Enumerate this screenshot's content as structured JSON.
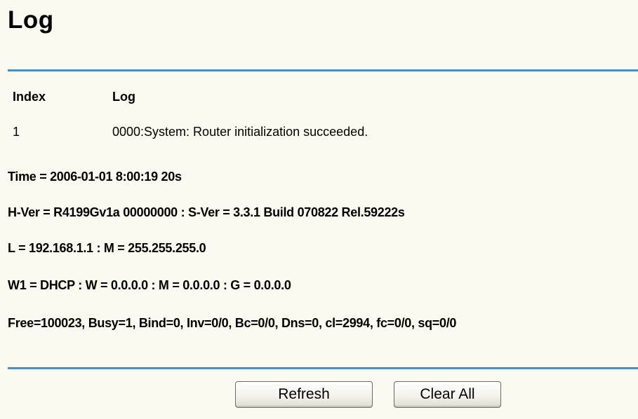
{
  "page": {
    "title": "Log"
  },
  "log_table": {
    "headers": {
      "index": "Index",
      "log": "Log"
    },
    "rows": [
      {
        "index": "1",
        "log": "0000:System: Router initialization succeeded."
      }
    ]
  },
  "system_info": {
    "time": "Time = 2006-01-01 8:00:19 20s",
    "version": "H-Ver = R4199Gv1a 00000000 : S-Ver = 3.3.1 Build 070822 Rel.59222s",
    "lan": "L = 192.168.1.1 : M = 255.255.255.0",
    "wan": "W1 = DHCP : W = 0.0.0.0 : M = 0.0.0.0 : G = 0.0.0.0",
    "stats": "Free=100023, Busy=1, Bind=0, Inv=0/0, Bc=0/0, Dns=0, cl=2994, fc=0/0, sq=0/0"
  },
  "buttons": {
    "refresh_label": "Refresh",
    "clear_all_label": "Clear All"
  },
  "colors": {
    "background": "#fbfaf0",
    "rule": "#3a93cf"
  }
}
